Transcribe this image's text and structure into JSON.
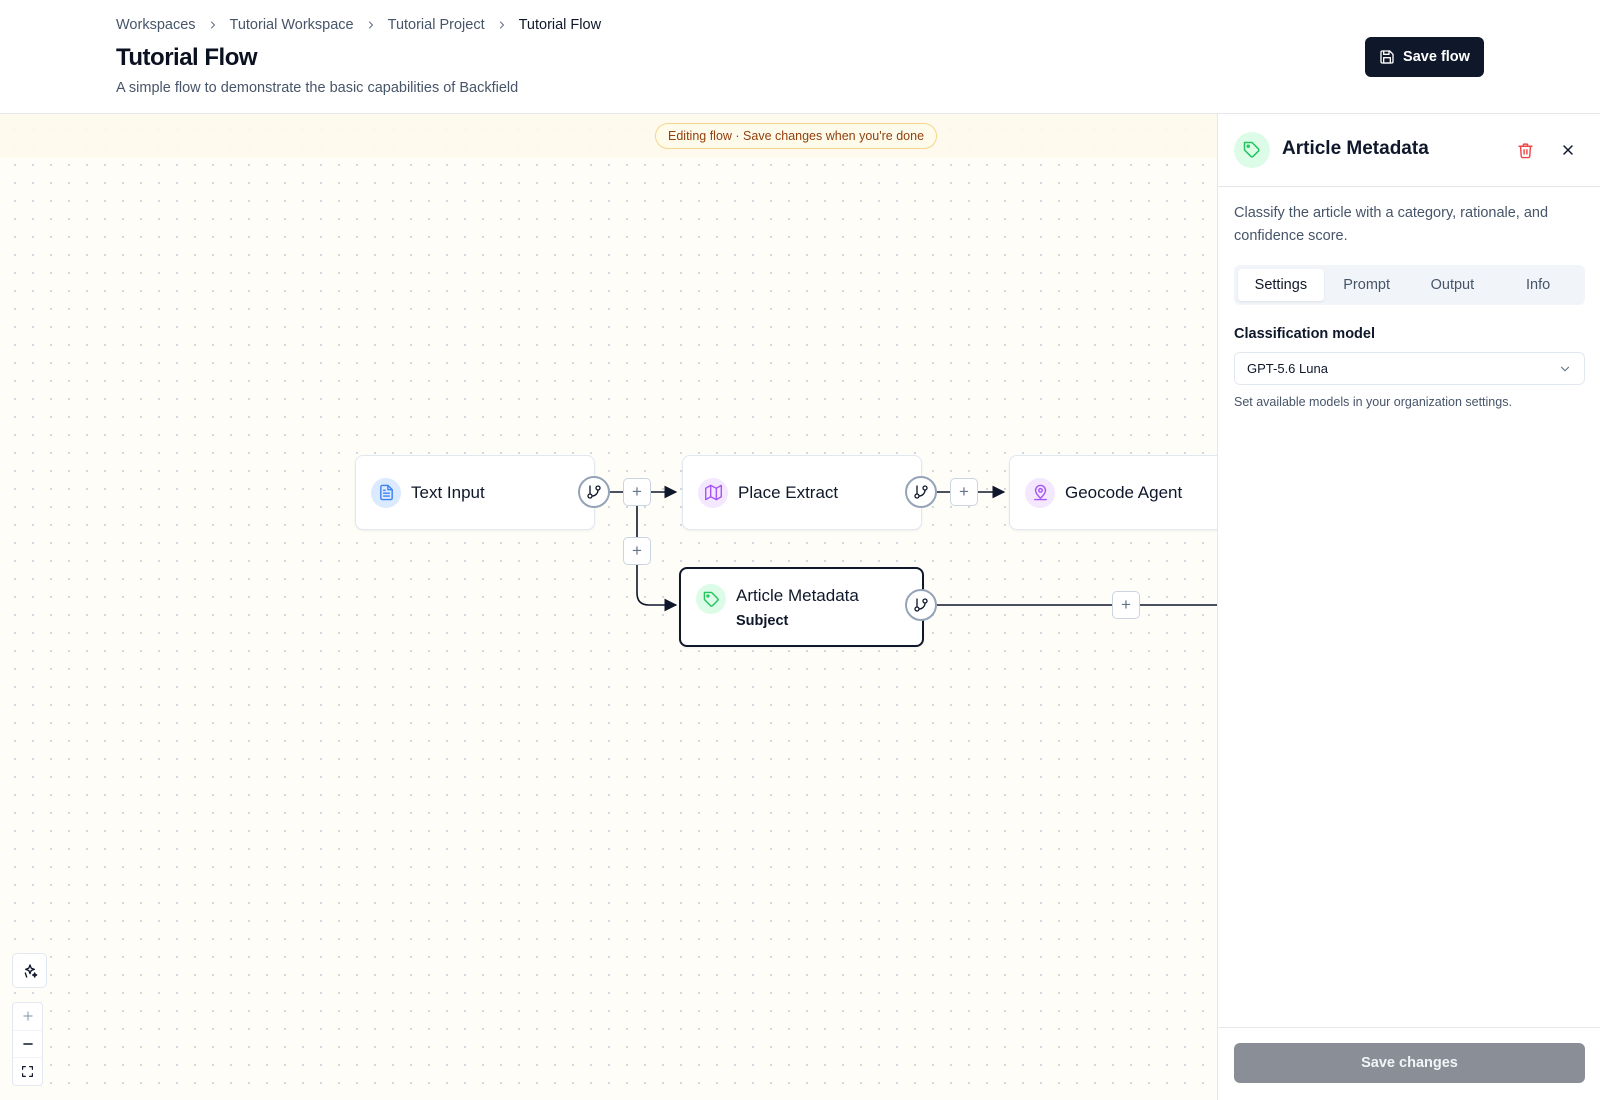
{
  "breadcrumb": [
    "Workspaces",
    "Tutorial Workspace",
    "Tutorial Project",
    "Tutorial Flow"
  ],
  "header": {
    "title": "Tutorial Flow",
    "description": "A simple flow to demonstrate the basic capabilities of Backfield",
    "save_label": "Save flow"
  },
  "canvas": {
    "banner": "Editing flow · Save changes when you're done",
    "nodes": {
      "text_input": {
        "label": "Text Input",
        "icon": "document-icon"
      },
      "place_extract": {
        "label": "Place Extract",
        "icon": "map-icon"
      },
      "geocode_agent": {
        "label": "Geocode Agent",
        "icon": "map-pin-user-icon"
      },
      "article_metadata": {
        "label": "Article Metadata",
        "sublabel": "Subject",
        "icon": "tag-icon"
      }
    },
    "plus_symbol": "+"
  },
  "panel": {
    "title": "Article Metadata",
    "description": "Classify the article with a category, rationale, and confidence score.",
    "tabs": [
      {
        "label": "Settings",
        "active": true
      },
      {
        "label": "Prompt",
        "active": false
      },
      {
        "label": "Output",
        "active": false
      },
      {
        "label": "Info",
        "active": false
      }
    ],
    "field_label": "Classification model",
    "model_value": "GPT-5.6 Luna",
    "hint": "Set available models in your organization settings.",
    "save_label": "Save changes"
  },
  "colors": {
    "primary": "#0f172a",
    "tag_green": "#22c55e",
    "map_purple": "#a855f7",
    "doc_blue": "#3b82f6",
    "danger": "#ef4444",
    "banner_text": "#92400e"
  }
}
